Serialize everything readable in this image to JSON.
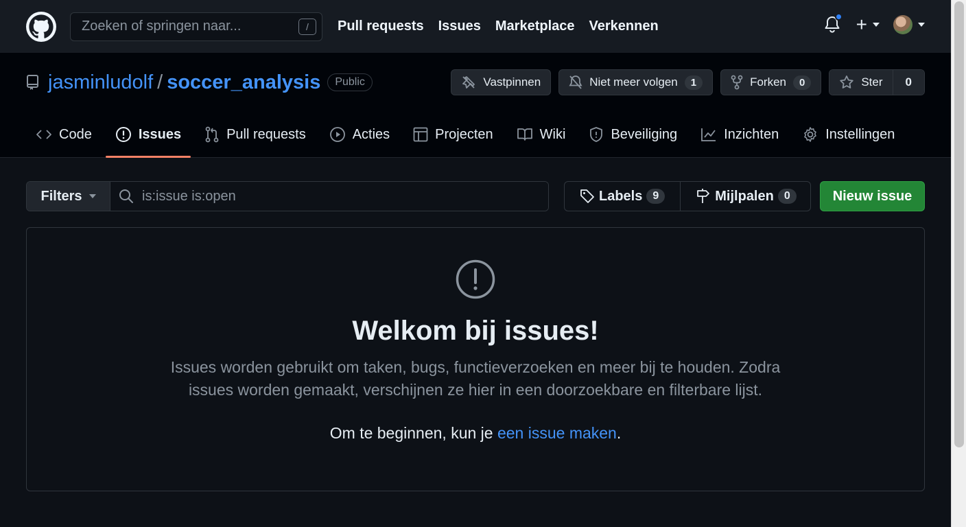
{
  "header": {
    "search_placeholder": "Zoeken of springen naar...",
    "slash_key": "/",
    "nav": [
      "Pull requests",
      "Issues",
      "Marketplace",
      "Verkennen"
    ],
    "notification_color": "#2f81f7"
  },
  "repo": {
    "owner": "jasminludolf",
    "separator": "/",
    "name": "soccer_analysis",
    "visibility": "Public",
    "pin_label": "Vastpinnen",
    "watch_label": "Niet meer volgen",
    "watch_count": "1",
    "fork_label": "Forken",
    "fork_count": "0",
    "star_label": "Ster",
    "star_count": "0"
  },
  "tabs": [
    {
      "label": "Code",
      "icon": "code-icon"
    },
    {
      "label": "Issues",
      "icon": "issue-opened-icon",
      "active": true
    },
    {
      "label": "Pull requests",
      "icon": "git-pull-request-icon"
    },
    {
      "label": "Acties",
      "icon": "play-icon"
    },
    {
      "label": "Projecten",
      "icon": "table-icon"
    },
    {
      "label": "Wiki",
      "icon": "book-icon"
    },
    {
      "label": "Beveiliging",
      "icon": "shield-icon"
    },
    {
      "label": "Inzichten",
      "icon": "graph-icon"
    },
    {
      "label": "Instellingen",
      "icon": "gear-icon"
    }
  ],
  "toolbar": {
    "filters_label": "Filters",
    "filter_value": "is:issue is:open",
    "labels_label": "Labels",
    "labels_count": "9",
    "milestones_label": "Mijlpalen",
    "milestones_count": "0",
    "new_issue_label": "Nieuw issue",
    "new_issue_color": "#238636"
  },
  "blankslate": {
    "title": "Welkom bij issues!",
    "description": "Issues worden gebruikt om taken, bugs, functieverzoeken en meer bij te houden. Zodra issues worden gemaakt, verschijnen ze hier in een doorzoekbare en filterbare lijst.",
    "start_prefix": "Om te beginnen, kun je ",
    "start_link": "een issue maken",
    "start_suffix": "."
  }
}
